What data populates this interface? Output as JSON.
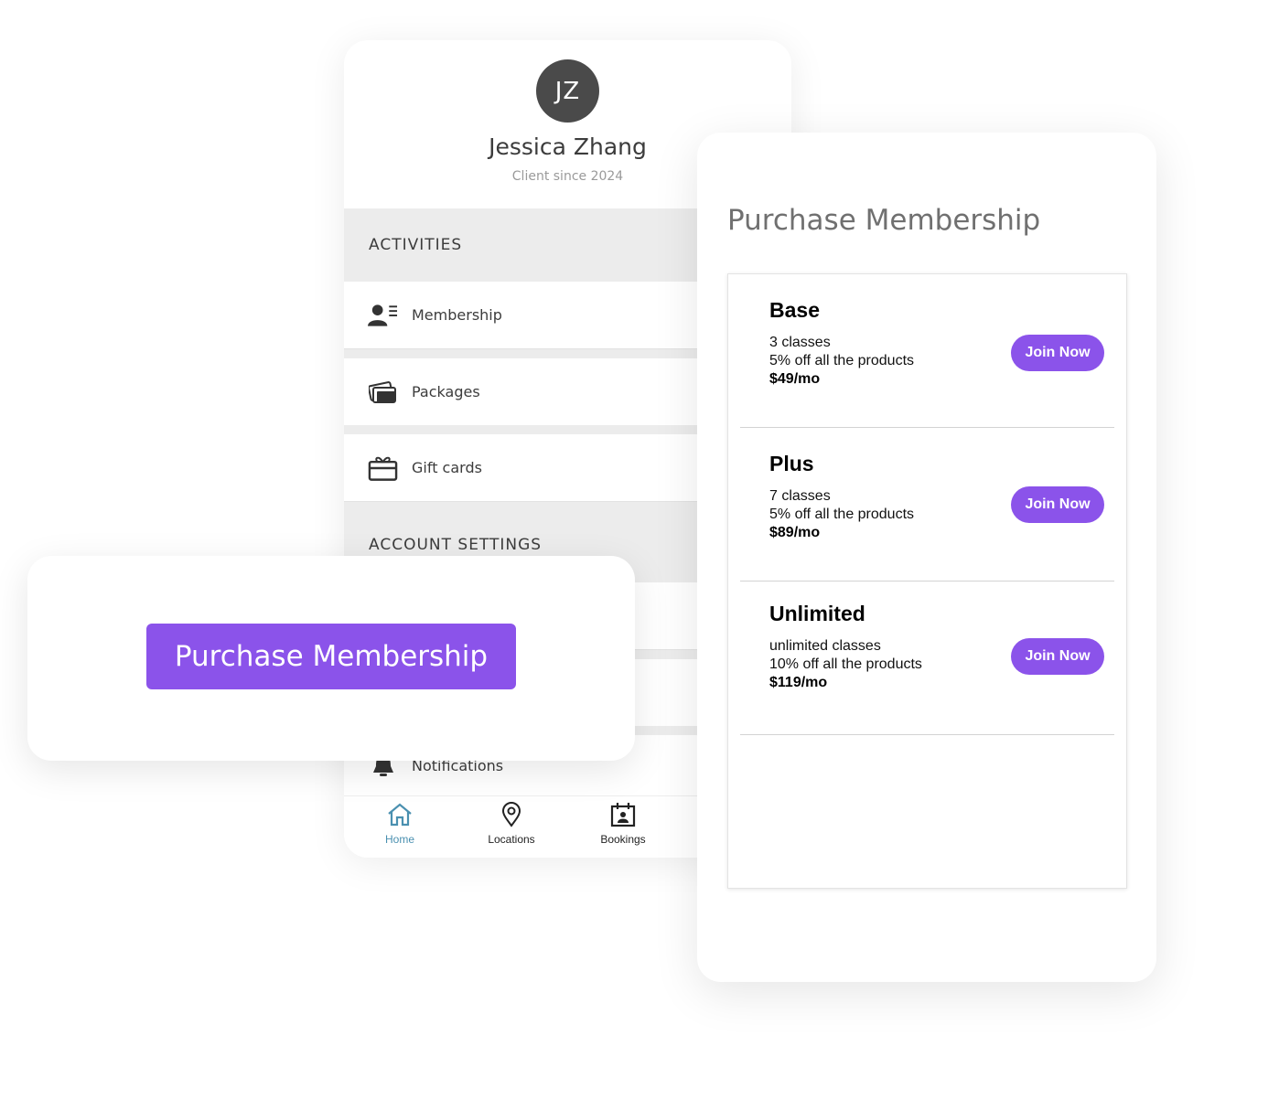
{
  "profile": {
    "initials": "JZ",
    "name": "Jessica Zhang",
    "subtitle": "Client since 2024",
    "sections": {
      "activities": "ACTIVITIES",
      "account_settings": "ACCOUNT SETTINGS"
    },
    "menu_items": [
      {
        "label": "Membership",
        "icon": "membership-card-icon"
      },
      {
        "label": "Packages",
        "icon": "packages-icon"
      },
      {
        "label": "Gift cards",
        "icon": "gift-card-icon"
      }
    ],
    "account_items": [
      {
        "label": "Notifications",
        "icon": "bell-icon"
      }
    ],
    "tabs": [
      {
        "label": "Home",
        "icon": "home-icon",
        "active": true
      },
      {
        "label": "Locations",
        "icon": "location-pin-icon",
        "active": false
      },
      {
        "label": "Bookings",
        "icon": "calendar-icon",
        "active": false
      }
    ]
  },
  "cta": {
    "label": "Purchase Membership"
  },
  "membership": {
    "title": "Purchase Membership",
    "plans": [
      {
        "name": "Base",
        "classes": "3 classes",
        "discount": "5% off all the products",
        "price": "$49/mo",
        "button": "Join Now"
      },
      {
        "name": "Plus",
        "classes": "7 classes",
        "discount": "5% off all the products",
        "price": "$89/mo",
        "button": "Join Now"
      },
      {
        "name": "Unlimited",
        "classes": "unlimited classes",
        "discount": "10% off all the products",
        "price": "$119/mo",
        "button": "Join Now"
      }
    ]
  },
  "colors": {
    "accent": "#8b53ea",
    "active_tab": "#4a90b0",
    "avatar_bg": "#4a4a4a",
    "section_bg": "#ececec"
  }
}
